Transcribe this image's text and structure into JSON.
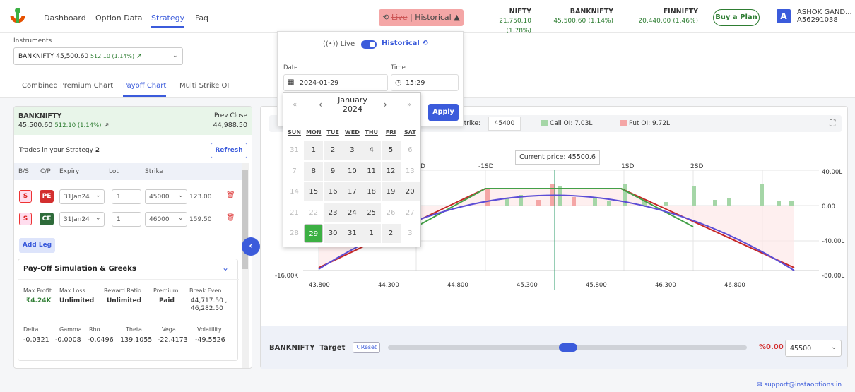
{
  "nav": {
    "links": [
      "Dashboard",
      "Option Data",
      "Strategy",
      "Faq"
    ],
    "mode_label_live": "Live",
    "mode_label": "| Historical ▲",
    "indices": [
      {
        "name": "NIFTY",
        "value": "21,750.10",
        "change": "(1.78%)"
      },
      {
        "name": "BANKNIFTY",
        "value": "45,500.60",
        "change": "(1.14%)"
      },
      {
        "name": "FINNIFTY",
        "value": "20,440.00",
        "change": "(1.46%)"
      }
    ],
    "buy_plan": "Buy a Plan",
    "avatar_letter": "A",
    "user_name": "ASHOK GAND...",
    "user_id": "A56291038"
  },
  "instruments": {
    "label": "Instruments",
    "name": "BANKNIFTY",
    "price": "45,500.60",
    "change": "512.10 (1.14%)",
    "arrow": "↗"
  },
  "tabs": [
    "Combined Premium Chart",
    "Payoff Chart",
    "Multi Strike OI"
  ],
  "left": {
    "symbol": "BANKNIFTY",
    "price": "45,500.60",
    "change": "512.10 (1.14%)",
    "arrow": "↗",
    "prev_close_label": "Prev Close",
    "prev_close": "44,988.50",
    "trades_label": "Trades in your Strategy",
    "trades_count": "2",
    "refresh": "Refresh",
    "cols": [
      "B/S",
      "C/P",
      "Expiry",
      "Lot",
      "Strike"
    ],
    "legs": [
      {
        "bs": "S",
        "cp": "PE",
        "expiry": "31Jan24",
        "lot": "1",
        "strike": "45000",
        "price": "123.00"
      },
      {
        "bs": "S",
        "cp": "CE",
        "expiry": "31Jan24",
        "lot": "1",
        "strike": "46000",
        "price": "159.50"
      }
    ],
    "add_leg": "Add Leg",
    "sim_title": "Pay-Off Simulation & Greeks",
    "stats": [
      {
        "label": "Max Profit",
        "value": "₹4.24K"
      },
      {
        "label": "Max Loss",
        "value": "Unlimited"
      },
      {
        "label": "Reward Ratio",
        "value": "Unlimited"
      },
      {
        "label": "Premium",
        "value": "Paid"
      },
      {
        "label": "Break Even",
        "value": "44,717.50 ,\n46,282.50"
      }
    ],
    "greeks": [
      {
        "label": "Delta",
        "value": "-0.0321"
      },
      {
        "label": "Gamma",
        "value": "-0.0008"
      },
      {
        "label": "Rho",
        "value": "-0.0496"
      },
      {
        "label": "Theta",
        "value": "139.1055"
      },
      {
        "label": "Vega",
        "value": "-22.4173"
      },
      {
        "label": "Volatility",
        "value": "-49.5526"
      }
    ]
  },
  "popup": {
    "live": "Live",
    "historical": "Historical",
    "date_label": "Date",
    "date_value": "2024-01-29",
    "time_label": "Time",
    "time_value": "15:29",
    "apply": "Apply"
  },
  "calendar": {
    "month": "January",
    "year": "2024",
    "dow": [
      "SUN",
      "MON",
      "TUE",
      "WED",
      "THU",
      "FRI",
      "SAT"
    ],
    "weeks": [
      [
        {
          "d": "31",
          "o": true
        },
        {
          "d": "1"
        },
        {
          "d": "2"
        },
        {
          "d": "3"
        },
        {
          "d": "4"
        },
        {
          "d": "5"
        },
        {
          "d": "6",
          "o": true
        }
      ],
      [
        {
          "d": "7",
          "o": true
        },
        {
          "d": "8"
        },
        {
          "d": "9"
        },
        {
          "d": "10"
        },
        {
          "d": "11"
        },
        {
          "d": "12"
        },
        {
          "d": "13",
          "o": true
        }
      ],
      [
        {
          "d": "14",
          "o": true
        },
        {
          "d": "15"
        },
        {
          "d": "16"
        },
        {
          "d": "17"
        },
        {
          "d": "18"
        },
        {
          "d": "19"
        },
        {
          "d": "20"
        }
      ],
      [
        {
          "d": "21",
          "o": true
        },
        {
          "d": "22",
          "o": true
        },
        {
          "d": "23"
        },
        {
          "d": "24"
        },
        {
          "d": "25"
        },
        {
          "d": "26",
          "o": true
        },
        {
          "d": "27",
          "o": true
        }
      ],
      [
        {
          "d": "28",
          "o": true
        },
        {
          "d": "29",
          "s": true
        },
        {
          "d": "30"
        },
        {
          "d": "31"
        },
        {
          "d": "1"
        },
        {
          "d": "2"
        },
        {
          "d": "3",
          "o": true
        }
      ]
    ]
  },
  "chart": {
    "strike_label": "Strike:",
    "strike_value": "45400",
    "call_oi": "Call OI: 7.03L",
    "put_oi": "Put OI: 9.72L",
    "current_price": "Current price: 45500.6",
    "sd_labels": [
      "-1SD",
      "1SD",
      "2SD"
    ],
    "sd_partial": "D",
    "x_ticks": [
      "43,800",
      "44,300",
      "44,800",
      "45,300",
      "45,800",
      "46,300",
      "46,800"
    ],
    "y_left": [
      "-16.00K"
    ],
    "y_right": [
      "40.00L",
      "0.00",
      "-40.00L",
      "-80.00L"
    ],
    "target_label": "BANKNIFTY  Target",
    "reset": "Reset",
    "pct": "%0.00",
    "target_value": "45500"
  },
  "footer": {
    "support": "support@instaoptions.in"
  },
  "colors": {
    "accent": "#3b5bdb",
    "green": "#3cb043",
    "red": "#d32f2f"
  }
}
